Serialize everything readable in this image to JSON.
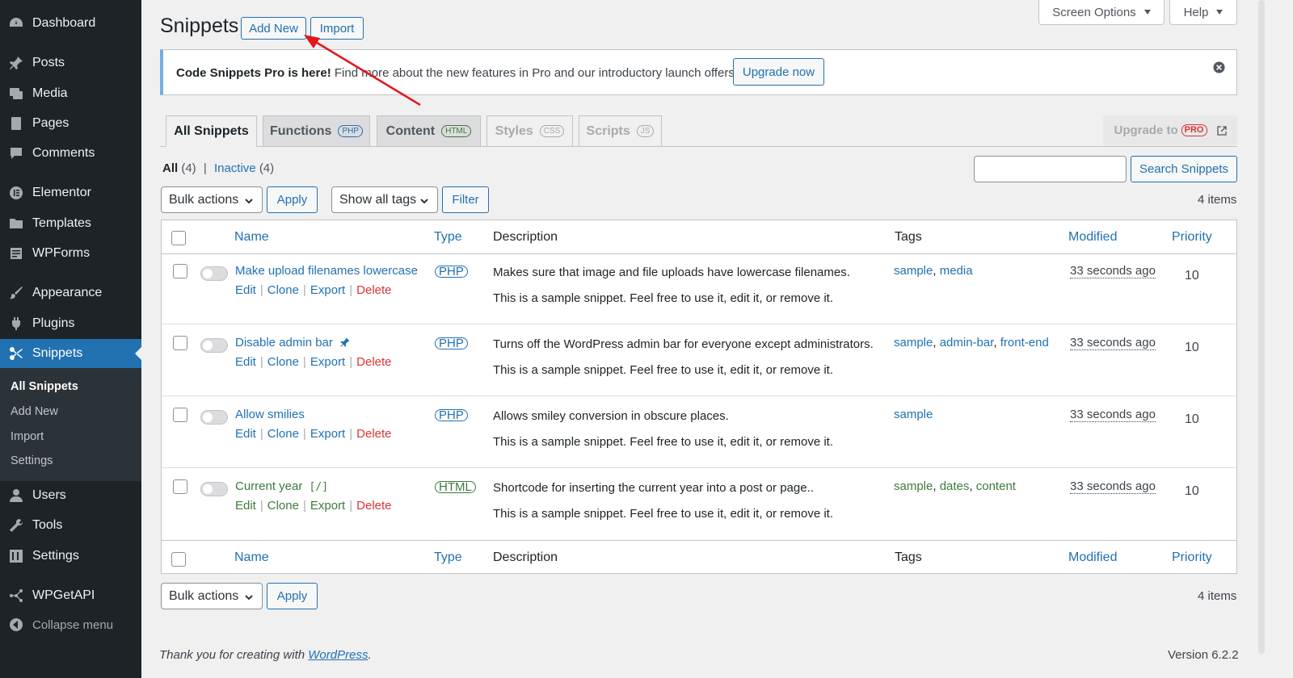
{
  "sidebar": {
    "items": [
      {
        "label": "Dashboard",
        "icon": "dashboard-icon"
      },
      {
        "label": "Posts",
        "icon": "pin-icon"
      },
      {
        "label": "Media",
        "icon": "media-icon"
      },
      {
        "label": "Pages",
        "icon": "pages-icon"
      },
      {
        "label": "Comments",
        "icon": "comment-icon"
      },
      {
        "label": "Elementor",
        "icon": "elementor-icon"
      },
      {
        "label": "Templates",
        "icon": "folder-icon"
      },
      {
        "label": "WPForms",
        "icon": "forms-icon"
      },
      {
        "label": "Appearance",
        "icon": "brush-icon"
      },
      {
        "label": "Plugins",
        "icon": "plugin-icon"
      },
      {
        "label": "Snippets",
        "icon": "scissors-icon"
      },
      {
        "label": "Users",
        "icon": "user-icon"
      },
      {
        "label": "Tools",
        "icon": "wrench-icon"
      },
      {
        "label": "Settings",
        "icon": "settings-icon"
      },
      {
        "label": "WPGetAPI",
        "icon": "network-icon"
      },
      {
        "label": "Collapse menu",
        "icon": "collapse-icon"
      }
    ],
    "submenu": [
      "All Snippets",
      "Add New",
      "Import",
      "Settings"
    ]
  },
  "header": {
    "title": "Snippets",
    "add_new": "Add New",
    "import": "Import",
    "screen_options": "Screen Options",
    "help": "Help"
  },
  "notice": {
    "strong": "Code Snippets Pro is here!",
    "text": "Find more about the new features in Pro and our introductory launch offers.",
    "button": "Upgrade now"
  },
  "tabs": [
    {
      "label": "All Snippets",
      "badge": ""
    },
    {
      "label": "Functions",
      "badge": "PHP"
    },
    {
      "label": "Content",
      "badge": "HTML"
    },
    {
      "label": "Styles",
      "badge": "CSS"
    },
    {
      "label": "Scripts",
      "badge": "JS"
    }
  ],
  "upgrade": {
    "label": "Upgrade to",
    "badge": "PRO"
  },
  "status": {
    "all": "All",
    "all_count": "(4)",
    "sep": "|",
    "inactive": "Inactive",
    "inactive_count": "(4)"
  },
  "filters": {
    "bulk_actions": "Bulk actions",
    "apply": "Apply",
    "tags": "Show all tags",
    "filter": "Filter",
    "search_button": "Search Snippets",
    "items": "4 items"
  },
  "columns": {
    "name": "Name",
    "type": "Type",
    "description": "Description",
    "tags": "Tags",
    "modified": "Modified",
    "priority": "Priority"
  },
  "row_actions": {
    "edit": "Edit",
    "clone": "Clone",
    "export": "Export",
    "delete": "Delete",
    "sep": "|"
  },
  "snippets": [
    {
      "name": "Make upload filenames lowercase",
      "type": "PHP",
      "desc1": "Makes sure that image and file uploads have lowercase filenames.",
      "desc2": "This is a sample snippet. Feel free to use it, edit it, or remove it.",
      "tags": [
        "sample",
        "media"
      ],
      "modified": "33 seconds ago",
      "priority": "10"
    },
    {
      "name": "Disable admin bar",
      "type": "PHP",
      "desc1": "Turns off the WordPress admin bar for everyone except administrators.",
      "desc2": "This is a sample snippet. Feel free to use it, edit it, or remove it.",
      "tags": [
        "sample",
        "admin-bar",
        "front-end"
      ],
      "modified": "33 seconds ago",
      "priority": "10"
    },
    {
      "name": "Allow smilies",
      "type": "PHP",
      "desc1": "Allows smiley conversion in obscure places.",
      "desc2": "This is a sample snippet. Feel free to use it, edit it, or remove it.",
      "tags": [
        "sample"
      ],
      "modified": "33 seconds ago",
      "priority": "10"
    },
    {
      "name": "Current year",
      "shortcode": "[/]",
      "type": "HTML",
      "desc1": "Shortcode for inserting the current year into a post or page..",
      "desc2": "This is a sample snippet. Feel free to use it, edit it, or remove it.",
      "tags": [
        "sample",
        "dates",
        "content"
      ],
      "modified": "33 seconds ago",
      "priority": "10"
    }
  ],
  "footer": {
    "thanks": "Thank you for creating with",
    "wordpress": "WordPress",
    "period": ".",
    "version": "Version 6.2.2"
  },
  "colors": {
    "sidebar_bg": "#1d2327",
    "active_menu": "#2271b1",
    "link": "#2271b1",
    "delete": "#d63638",
    "html_green": "#3c7a3c",
    "annotation_arrow": "#e3161e"
  },
  "annotation": {
    "arrow_icon": "red-arrow-icon"
  }
}
